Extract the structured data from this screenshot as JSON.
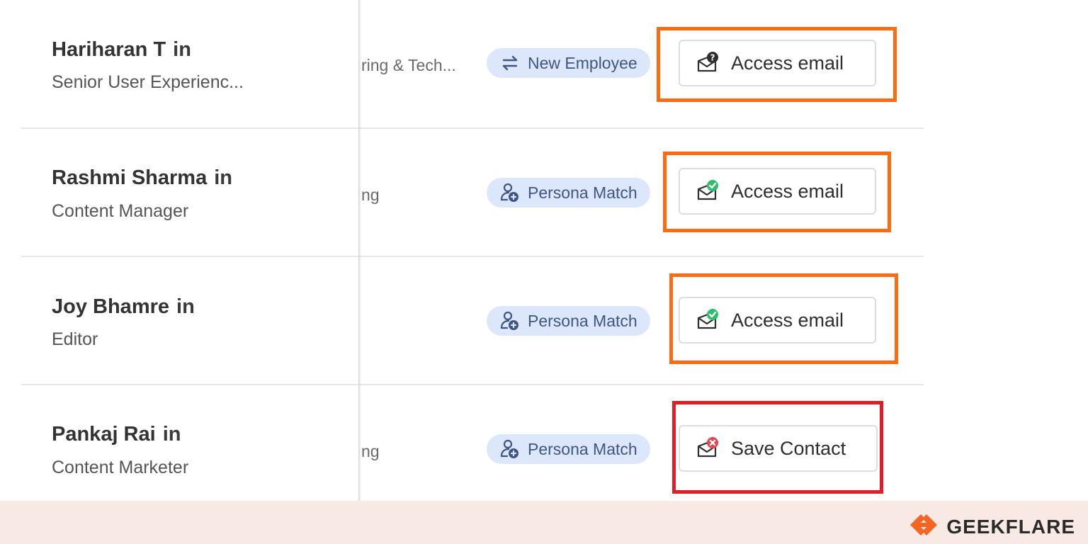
{
  "rows": [
    {
      "name": "Hariharan T",
      "linkedin": "in",
      "title": "Senior User Experienc...",
      "dept": "ring & Tech...",
      "tag": {
        "label": "New Employee",
        "icon": "swap-arrows-icon"
      },
      "action": {
        "label": "Access email",
        "icon": "mail-question-icon",
        "status": "unknown"
      },
      "highlight": "orange"
    },
    {
      "name": "Rashmi Sharma",
      "linkedin": "in",
      "title": "Content Manager",
      "dept": "ng",
      "tag": {
        "label": "Persona Match",
        "icon": "persona-match-icon"
      },
      "action": {
        "label": "Access email",
        "icon": "mail-verified-icon",
        "status": "verified"
      },
      "highlight": "orange"
    },
    {
      "name": "Joy Bhamre",
      "linkedin": "in",
      "title": "Editor",
      "dept": "",
      "tag": {
        "label": "Persona Match",
        "icon": "persona-match-icon"
      },
      "action": {
        "label": "Access email",
        "icon": "mail-verified-icon",
        "status": "verified"
      },
      "highlight": "orange"
    },
    {
      "name": "Pankaj Rai",
      "linkedin": "in",
      "title": "Content Marketer",
      "dept": "ng",
      "tag": {
        "label": "Persona Match",
        "icon": "persona-match-icon"
      },
      "action": {
        "label": "Save Contact",
        "icon": "mail-error-icon",
        "status": "unavailable"
      },
      "highlight": "red"
    }
  ],
  "footer": {
    "brand": "GEEKFLARE",
    "logo_icon": "geekflare-logo-icon"
  },
  "colors": {
    "highlight_orange": "#ff6a13",
    "highlight_red": "#e11d2a",
    "tag_bg": "#dde7fb",
    "verified_green": "#2ebd6b",
    "error_red": "#e8434f",
    "brand_orange": "#f26522",
    "footer_bg": "#f8e9e5"
  }
}
